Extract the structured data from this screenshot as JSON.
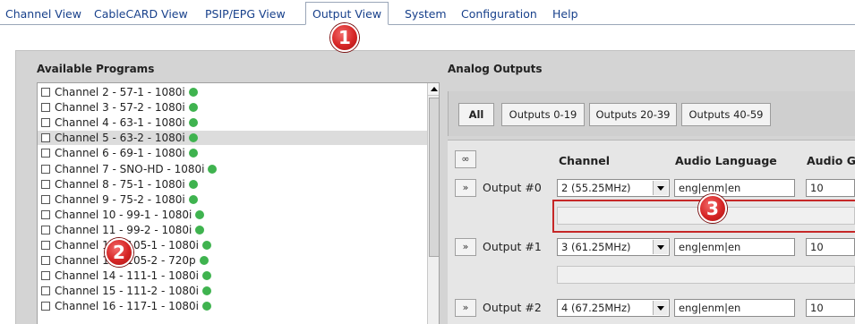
{
  "tabs": [
    {
      "label": "Channel View"
    },
    {
      "label": "CableCARD View"
    },
    {
      "label": "PSIP/EPG View"
    },
    {
      "label": "Output View"
    },
    {
      "label": "System"
    },
    {
      "label": "Configuration"
    },
    {
      "label": "Help"
    }
  ],
  "active_tab": "Output View",
  "available_programs": {
    "title": "Available Programs",
    "items": [
      {
        "label": "Channel 2 - 57-1 - 1080i",
        "checked": false,
        "status": "green"
      },
      {
        "label": "Channel 3 - 57-2 - 1080i",
        "checked": false,
        "status": "green"
      },
      {
        "label": "Channel 4 - 63-1 - 1080i",
        "checked": false,
        "status": "green"
      },
      {
        "label": "Channel 5 - 63-2 - 1080i",
        "checked": false,
        "status": "green",
        "selected": true
      },
      {
        "label": "Channel 6 - 69-1 - 1080i",
        "checked": false,
        "status": "green"
      },
      {
        "label": "Channel 7 - SNO-HD - 1080i",
        "checked": false,
        "status": "green"
      },
      {
        "label": "Channel 8 - 75-1 - 1080i",
        "checked": false,
        "status": "green"
      },
      {
        "label": "Channel 9 - 75-2 - 1080i",
        "checked": false,
        "status": "green"
      },
      {
        "label": "Channel 10 - 99-1 - 1080i",
        "checked": false,
        "status": "green"
      },
      {
        "label": "Channel 11 - 99-2 - 1080i",
        "checked": false,
        "status": "green"
      },
      {
        "label": "Channel 12 - 105-1 - 1080i",
        "checked": false,
        "status": "green"
      },
      {
        "label": "Channel 13 - 105-2 - 720p",
        "checked": false,
        "status": "green"
      },
      {
        "label": "Channel 14 - 111-1 - 1080i",
        "checked": false,
        "status": "green"
      },
      {
        "label": "Channel 15 - 111-2 - 1080i",
        "checked": false,
        "status": "green"
      },
      {
        "label": "Channel 16 - 117-1 - 1080i",
        "checked": false,
        "status": "green"
      }
    ]
  },
  "analog_outputs": {
    "title": "Analog Outputs",
    "filters": [
      "All",
      "Outputs 0-19",
      "Outputs 20-39",
      "Outputs 40-59"
    ],
    "active_filter": "All",
    "columns": {
      "channel": "Channel",
      "audio_language": "Audio Language",
      "audio_gain": "Audio Ga"
    },
    "expand_all_symbol": "∞",
    "expand_symbol": "»",
    "rows": [
      {
        "label": "Output #0",
        "channel": "2 (55.25MHz)",
        "audio_language": "eng|enm|en",
        "audio_gain": "10"
      },
      {
        "label": "Output #1",
        "channel": "3 (61.25MHz)",
        "audio_language": "eng|enm|en",
        "audio_gain": "10"
      },
      {
        "label": "Output #2",
        "channel": "4 (67.25MHz)",
        "audio_language": "eng|enm|en",
        "audio_gain": "10"
      }
    ]
  },
  "callouts": [
    "1",
    "2",
    "3"
  ],
  "colors": {
    "link": "#17408b",
    "status_green": "#3fb34f",
    "callout_red": "#d62525",
    "panel_bg": "#d4d4d4"
  }
}
